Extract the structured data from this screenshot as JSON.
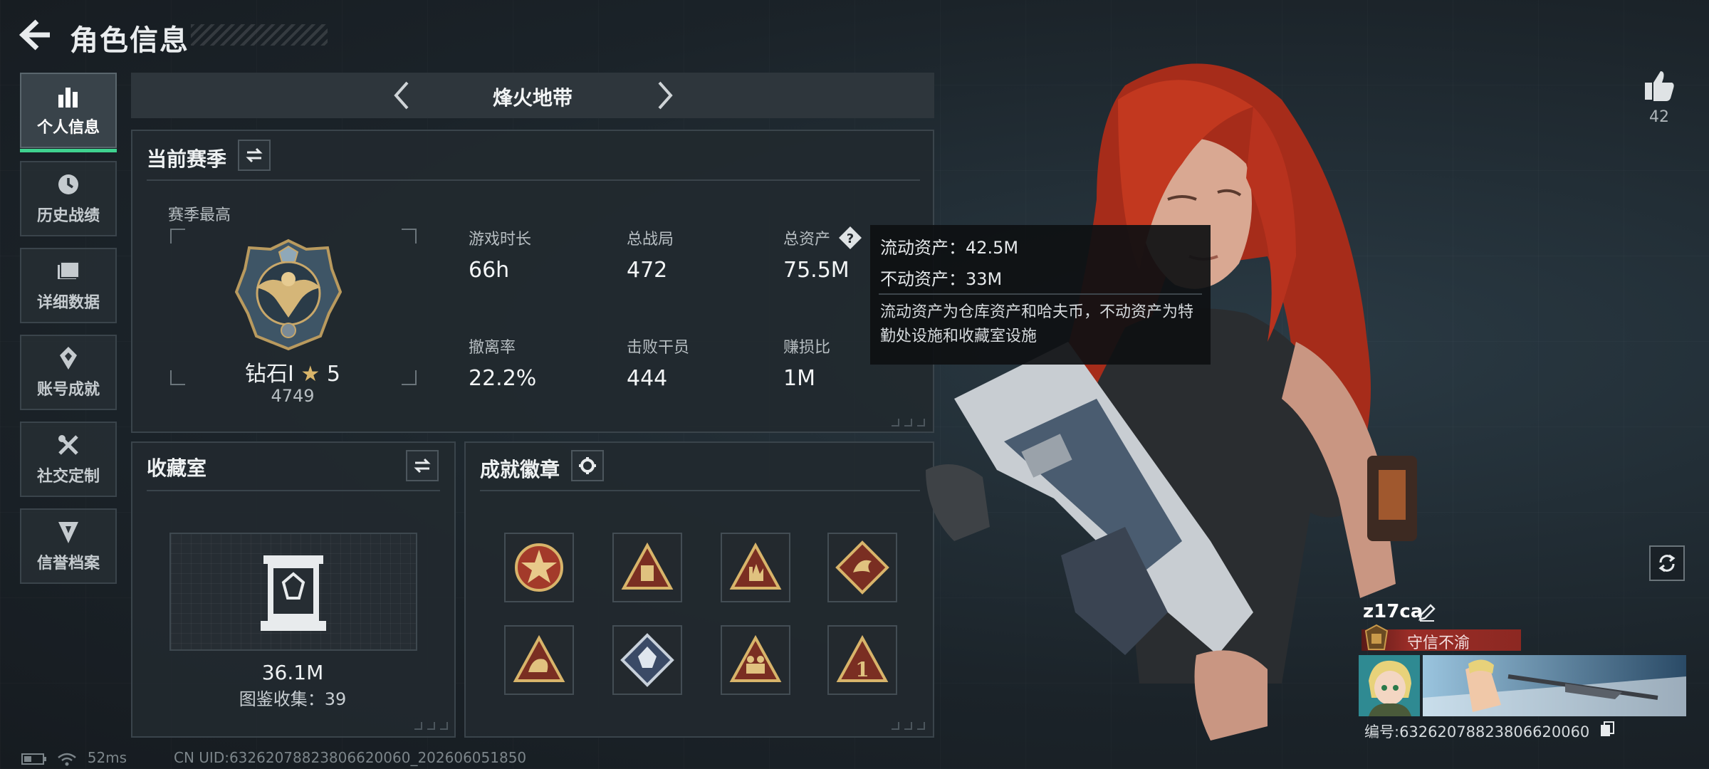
{
  "header": {
    "title": "角色信息"
  },
  "nav": [
    {
      "label": "个人信息",
      "icon": "bar-chart-icon",
      "active": true
    },
    {
      "label": "历史战绩",
      "icon": "history-clock-icon"
    },
    {
      "label": "详细数据",
      "icon": "folder-icon"
    },
    {
      "label": "账号成就",
      "icon": "achievement-icon"
    },
    {
      "label": "社交定制",
      "icon": "tools-icon"
    },
    {
      "label": "信誉档案",
      "icon": "credit-shield-icon"
    }
  ],
  "mode": {
    "title": "烽火地带"
  },
  "season": {
    "title": "当前赛季",
    "best_label": "赛季最高",
    "rank_name": "钻石I",
    "rank_stars": "5",
    "rank_score": "4749",
    "stats": [
      {
        "label": "游戏时长",
        "value": "66h"
      },
      {
        "label": "总战局",
        "value": "472"
      },
      {
        "label": "总资产",
        "value": "75.5M"
      },
      {
        "label": "撤离率",
        "value": "22.2%"
      },
      {
        "label": "击败干员",
        "value": "444"
      },
      {
        "label": "赚损比",
        "value": "1M"
      }
    ]
  },
  "tooltip": {
    "liquid": "流动资产：42.5M",
    "fixed": "不动资产：33M",
    "desc": "流动资产为仓库资产和哈夫币，不动资产为特勤处设施和收藏室设施"
  },
  "vault": {
    "title": "收藏室",
    "value": "36.1M",
    "collection": "图鉴收集：39"
  },
  "badges": {
    "title": "成就徽章"
  },
  "player": {
    "likes": "42",
    "name": "z17ca",
    "title_badge": "守信不渝",
    "uid_label": "编号:63262078823806620060"
  },
  "footer": {
    "ping": "52ms",
    "uid": "CN UID:63262078823806620060_202606051850"
  },
  "colors": {
    "accent_green": "#3fd28f",
    "title_red": "#9a2d27",
    "hair": "#b8321e"
  }
}
